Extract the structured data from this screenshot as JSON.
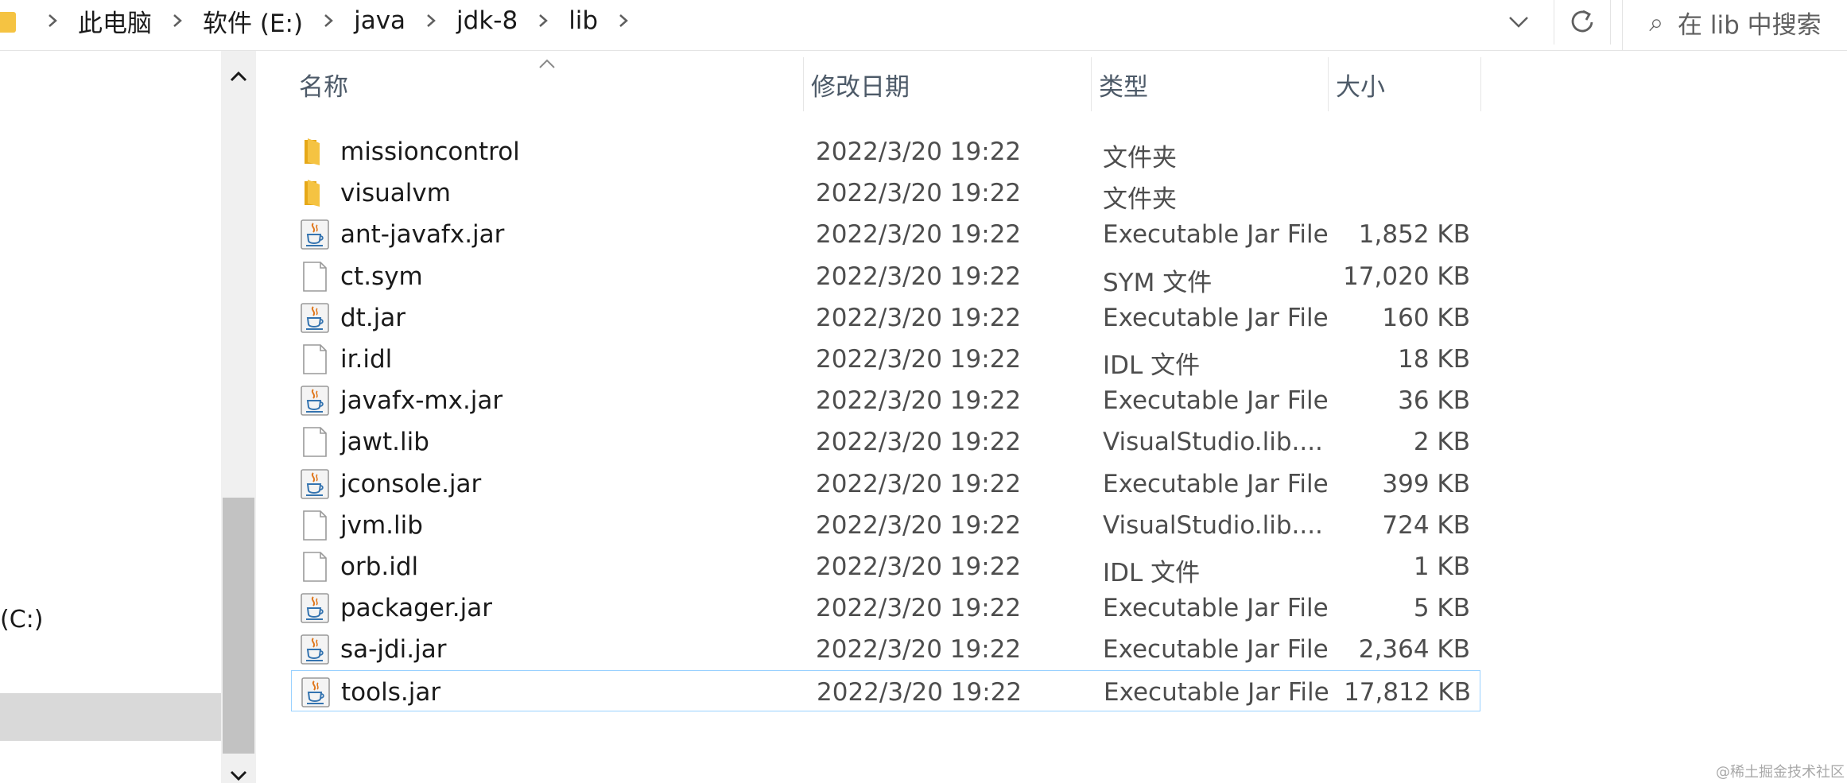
{
  "address_bar": {
    "breadcrumbs": [
      "此电脑",
      "软件 (E:)",
      "java",
      "jdk-8",
      "lib"
    ]
  },
  "search": {
    "placeholder": "在 lib 中搜索"
  },
  "nav": {
    "drive_label": "(C:)"
  },
  "columns": {
    "name": "名称",
    "modified": "修改日期",
    "type": "类型",
    "size": "大小"
  },
  "files": [
    {
      "name": "missioncontrol",
      "modified": "2022/3/20 19:22",
      "type": "文件夹",
      "size": "",
      "icon": "folder-icon"
    },
    {
      "name": "visualvm",
      "modified": "2022/3/20 19:22",
      "type": "文件夹",
      "size": "",
      "icon": "folder-icon"
    },
    {
      "name": "ant-javafx.jar",
      "modified": "2022/3/20 19:22",
      "type": "Executable Jar File",
      "size": "1,852 KB",
      "icon": "java-jar-icon"
    },
    {
      "name": "ct.sym",
      "modified": "2022/3/20 19:22",
      "type": "SYM 文件",
      "size": "17,020 KB",
      "icon": "file-icon"
    },
    {
      "name": "dt.jar",
      "modified": "2022/3/20 19:22",
      "type": "Executable Jar File",
      "size": "160 KB",
      "icon": "java-jar-icon"
    },
    {
      "name": "ir.idl",
      "modified": "2022/3/20 19:22",
      "type": "IDL 文件",
      "size": "18 KB",
      "icon": "file-icon"
    },
    {
      "name": "javafx-mx.jar",
      "modified": "2022/3/20 19:22",
      "type": "Executable Jar File",
      "size": "36 KB",
      "icon": "java-jar-icon"
    },
    {
      "name": "jawt.lib",
      "modified": "2022/3/20 19:22",
      "type": "VisualStudio.lib....",
      "size": "2 KB",
      "icon": "file-icon"
    },
    {
      "name": "jconsole.jar",
      "modified": "2022/3/20 19:22",
      "type": "Executable Jar File",
      "size": "399 KB",
      "icon": "java-jar-icon"
    },
    {
      "name": "jvm.lib",
      "modified": "2022/3/20 19:22",
      "type": "VisualStudio.lib....",
      "size": "724 KB",
      "icon": "file-icon"
    },
    {
      "name": "orb.idl",
      "modified": "2022/3/20 19:22",
      "type": "IDL 文件",
      "size": "1 KB",
      "icon": "file-icon"
    },
    {
      "name": "packager.jar",
      "modified": "2022/3/20 19:22",
      "type": "Executable Jar File",
      "size": "5 KB",
      "icon": "java-jar-icon"
    },
    {
      "name": "sa-jdi.jar",
      "modified": "2022/3/20 19:22",
      "type": "Executable Jar File",
      "size": "2,364 KB",
      "icon": "java-jar-icon"
    },
    {
      "name": "tools.jar",
      "modified": "2022/3/20 19:22",
      "type": "Executable Jar File",
      "size": "17,812 KB",
      "icon": "java-jar-icon",
      "selected": true
    }
  ],
  "watermark": "@稀土掘金技术社区",
  "colors": {
    "folder": "#f5c342",
    "selection_border": "#99d1ff",
    "header_text": "#4d5a68",
    "scrollbar_thumb": "#c2c2c2"
  }
}
